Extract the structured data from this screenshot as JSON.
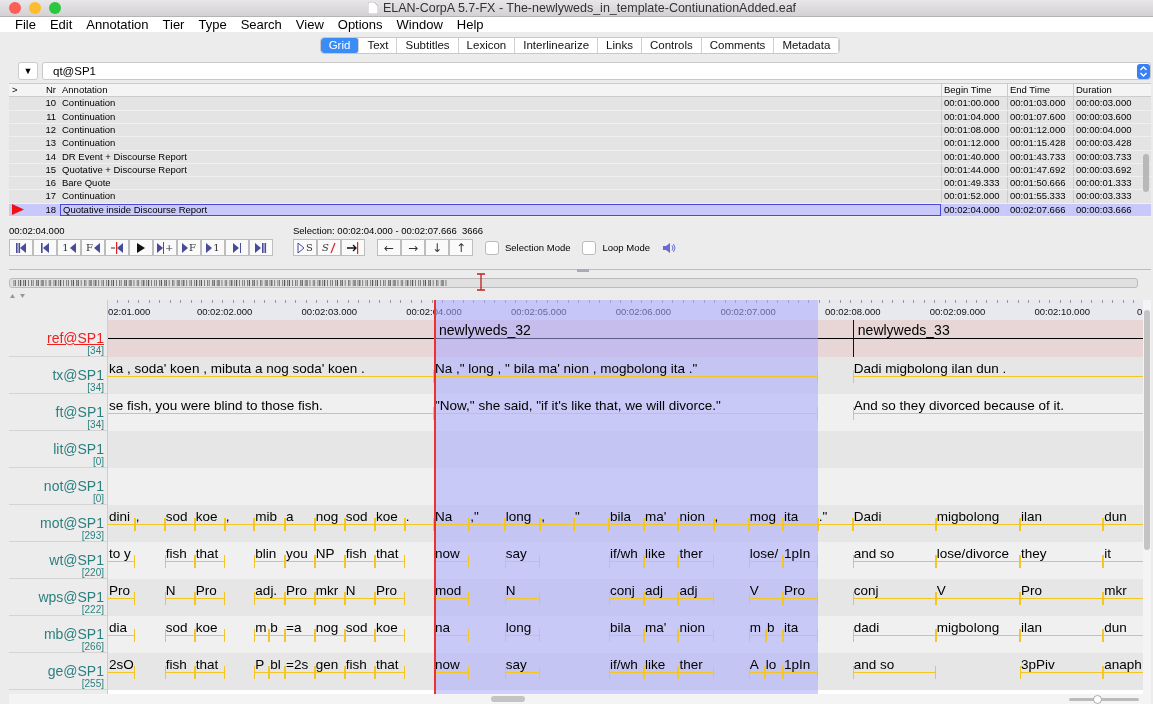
{
  "window": {
    "title": "ELAN-CorpA 5.7-FX - The-newlyweds_in_template-ContiunationAdded.eaf"
  },
  "menu": [
    "File",
    "Edit",
    "Annotation",
    "Tier",
    "Type",
    "Search",
    "View",
    "Options",
    "Window",
    "Help"
  ],
  "tabs": [
    {
      "label": "Grid",
      "selected": true
    },
    {
      "label": "Text",
      "selected": false
    },
    {
      "label": "Subtitles",
      "selected": false
    },
    {
      "label": "Lexicon",
      "selected": false
    },
    {
      "label": "Interlinearize",
      "selected": false
    },
    {
      "label": "Links",
      "selected": false
    },
    {
      "label": "Controls",
      "selected": false
    },
    {
      "label": "Comments",
      "selected": false
    },
    {
      "label": "Metadata",
      "selected": false
    }
  ],
  "tier_select": {
    "toggle": "▼",
    "value": "qt@SP1"
  },
  "grid": {
    "columns": [
      ">",
      "Nr",
      "Annotation",
      "Begin Time",
      "End Time",
      "Duration"
    ],
    "rows": [
      {
        "nr": "10",
        "annotation": "Continuation",
        "begin": "00:01:00.000",
        "end": "00:01:03.000",
        "duration": "00:00:03.000",
        "selected": false
      },
      {
        "nr": "11",
        "annotation": "Continuation",
        "begin": "00:01:04.000",
        "end": "00:01:07.600",
        "duration": "00:00:03.600",
        "selected": false
      },
      {
        "nr": "12",
        "annotation": "Continuation",
        "begin": "00:01:08.000",
        "end": "00:01:12.000",
        "duration": "00:00:04.000",
        "selected": false
      },
      {
        "nr": "13",
        "annotation": "Continuation",
        "begin": "00:01:12.000",
        "end": "00:01:15.428",
        "duration": "00:00:03.428",
        "selected": false
      },
      {
        "nr": "14",
        "annotation": "DR Event + Discourse Report",
        "begin": "00:01:40.000",
        "end": "00:01:43.733",
        "duration": "00:00:03.733",
        "selected": false
      },
      {
        "nr": "15",
        "annotation": "Quotative + Discourse Report",
        "begin": "00:01:44.000",
        "end": "00:01:47.692",
        "duration": "00:00:03.692",
        "selected": false
      },
      {
        "nr": "16",
        "annotation": "Bare Quote",
        "begin": "00:01:49.333",
        "end": "00:01:50.666",
        "duration": "00:00:01.333",
        "selected": false
      },
      {
        "nr": "17",
        "annotation": "Continuation",
        "begin": "00:01:52.000",
        "end": "00:01:55.333",
        "duration": "00:00:03.333",
        "selected": false
      },
      {
        "nr": "18",
        "annotation": "Quotative inside Discourse Report",
        "begin": "00:02:04.000",
        "end": "00:02:07.666",
        "duration": "00:00:03.666",
        "selected": true
      }
    ]
  },
  "media": {
    "current_time": "00:02:04.000",
    "selection": {
      "label": "Selection:",
      "begin": "00:02:04.000",
      "separator": "-",
      "end": "00:02:07.666",
      "length": "3666"
    },
    "buttons": [
      {
        "kind": "begin"
      },
      {
        "kind": "prev-scroll"
      },
      {
        "kind": "prev-second",
        "label": "1"
      },
      {
        "kind": "prev-frame",
        "label": "F"
      },
      {
        "kind": "prev-boundary"
      },
      {
        "kind": "play"
      },
      {
        "kind": "next-boundary",
        "label": "+"
      },
      {
        "kind": "next-frame",
        "label": "F"
      },
      {
        "kind": "next-second",
        "label": "1"
      },
      {
        "kind": "next-scroll"
      },
      {
        "kind": "end"
      }
    ],
    "selection_buttons": [
      {
        "kind": "play-selection",
        "label": "S"
      },
      {
        "kind": "clear-selection",
        "label": "S"
      },
      {
        "kind": "to-selection-end"
      }
    ],
    "arrow_buttons": [
      "←",
      "→",
      "↓",
      "↑"
    ],
    "checkboxes": [
      {
        "label": "Selection Mode",
        "checked": false
      },
      {
        "label": "Loop Mode",
        "checked": false
      }
    ]
  },
  "ruler": [
    "02:01.000",
    "00:02:02.000",
    "00:02:03.000",
    "00:02:04.000",
    "00:02:05.000",
    "00:02:06.000",
    "00:02:07.000",
    "00:02:08.000",
    "00:02:09.000",
    "00:02:10.000",
    "0"
  ],
  "tiers": [
    {
      "name": "ref@SP1",
      "count": "[34]",
      "active": true,
      "kind": "ref",
      "annotations": [
        "newlyweds_32",
        "newlyweds_33"
      ]
    },
    {
      "name": "tx@SP1",
      "count": "[34]",
      "active": false,
      "kind": "text",
      "annotations": [
        "ka , soda' koen , mibuta a nog soda' koen .",
        "Na ,\" long , \" bila ma' nion , mogbolong ita .\"",
        "Dadi migbolong ilan dun ."
      ]
    },
    {
      "name": "ft@SP1",
      "count": "[34]",
      "active": false,
      "kind": "text",
      "annotations": [
        "se fish, you were blind to those fish.",
        "\"Now,\" she said, \"if it's like that, we will divorce.\"",
        "And so they divorced because of it."
      ]
    },
    {
      "name": "lit@SP1",
      "count": "[0]",
      "active": false,
      "kind": "text"
    },
    {
      "name": "not@SP1",
      "count": "[0]",
      "active": false,
      "kind": "text"
    },
    {
      "name": "mot@SP1",
      "count": "[293]",
      "active": false,
      "kind": "text",
      "annotations": [
        "dini",
        ",",
        "sod",
        "koe",
        ",",
        "mib",
        "a",
        "nog",
        "sod",
        "koe",
        ".",
        "Na",
        ",\"",
        "long",
        ",",
        "\"",
        "bila",
        "ma'",
        "nion",
        ",",
        "mog",
        "ita",
        ".\"",
        "Dadi",
        "migbolong",
        "ilan",
        "dun"
      ]
    },
    {
      "name": "wt@SP1",
      "count": "[220]",
      "active": false,
      "kind": "text",
      "annotations": [
        "to y",
        "fish",
        "that",
        "blin",
        "you",
        "NP",
        "fish",
        "that",
        "now",
        "say",
        "if/wh",
        "like",
        "ther",
        "lose/",
        "1pIn",
        "and so",
        "lose/divorce",
        "they",
        "it"
      ]
    },
    {
      "name": "wps@SP1",
      "count": "[222]",
      "active": false,
      "kind": "text",
      "annotations": [
        "Pro",
        "N",
        "Pro",
        "adj.",
        "Pro",
        "mkr",
        "N",
        "Pro",
        "mod",
        "N",
        "conj",
        "adj",
        "adj",
        "V",
        "Pro",
        "conj",
        "V",
        "Pro",
        "mkr"
      ]
    },
    {
      "name": "mb@SP1",
      "count": "[266]",
      "active": false,
      "kind": "text",
      "annotations": [
        "dia",
        "sod",
        "koe",
        "m",
        "b",
        "=a",
        "nog",
        "sod",
        "koe",
        "na",
        "long",
        "bila",
        "ma'",
        "nion",
        "m",
        "b",
        "ita",
        "dadi",
        "migbolong",
        "ilan",
        "dun"
      ]
    },
    {
      "name": "ge@SP1",
      "count": "[255]",
      "active": false,
      "kind": "text",
      "annotations": [
        "2sO",
        "fish",
        "that",
        "P",
        "bl",
        "=2s",
        "gen",
        "fish",
        "that",
        "now",
        "say",
        "if/wh",
        "like",
        "ther",
        "A",
        "lo",
        "1pIn",
        "and so",
        "3pPiv",
        "anaph"
      ]
    }
  ],
  "zoom_slider": {
    "level": 0.4
  }
}
